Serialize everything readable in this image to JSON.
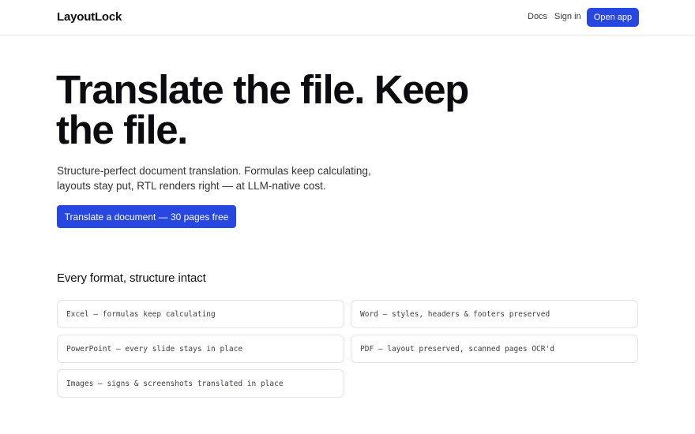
{
  "header": {
    "logo": "LayoutLock",
    "nav": {
      "docs": "Docs",
      "signin": "Sign in",
      "open_app": "Open app"
    }
  },
  "hero": {
    "headline": "Translate the file. Keep the file.",
    "subhead": "Structure-perfect document translation. Formulas keep calculating, layouts stay put, RTL renders right — at LLM-native cost.",
    "cta": "Translate a document — 30 pages free"
  },
  "formats": {
    "title": "Every format, structure intact",
    "items": [
      "Excel — formulas keep calculating",
      "Word — styles, headers & footers preserved",
      "PowerPoint — every slide stays in place",
      "PDF — layout preserved, scanned pages OCR'd",
      "Images — signs & screenshots translated in place"
    ]
  },
  "colors": {
    "accent": "#2847e0",
    "text": "#0f0f12",
    "border": "#e2e2e6"
  }
}
